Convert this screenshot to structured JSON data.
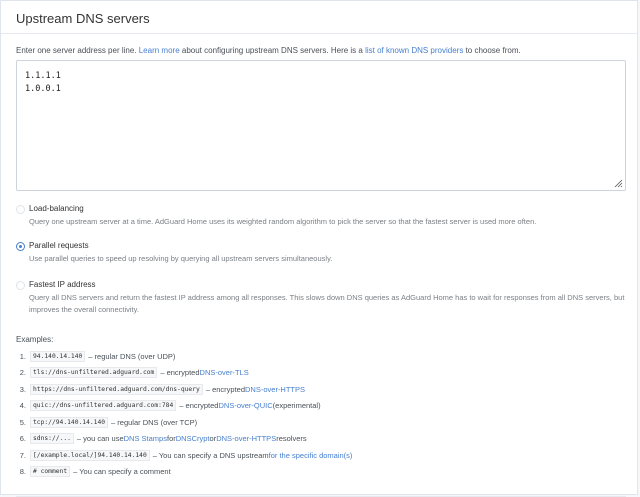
{
  "header": {
    "title": "Upstream DNS servers"
  },
  "description": {
    "part1": "Enter one server address per line. ",
    "learn_more": "Learn more",
    "part2": " about configuring upstream DNS servers. Here is a ",
    "providers_link": "list of known DNS providers",
    "part3": " to choose from."
  },
  "textarea": {
    "lines": "1.1.1.1\n1.0.0.1"
  },
  "modes": [
    {
      "title": "Load-balancing",
      "description": "Query one upstream server at a time. AdGuard Home uses its weighted random algorithm to pick the server so that the fastest server is used more often.",
      "checked": false
    },
    {
      "title": "Parallel requests",
      "description": "Use parallel queries to speed up resolving by querying all upstream servers simultaneously.",
      "checked": true
    },
    {
      "title": "Fastest IP address",
      "description": "Query all DNS servers and return the fastest IP address among all responses. This slows down DNS queries as AdGuard Home has to wait for responses from all DNS servers, but improves the overall connectivity.",
      "checked": false
    }
  ],
  "examples": {
    "title": "Examples:",
    "items": [
      {
        "num": "1.",
        "code": "94.140.14.140",
        "pre": " – regular DNS (over UDP)",
        "link": "",
        "post": ""
      },
      {
        "num": "2.",
        "code": "tls://dns-unfiltered.adguard.com",
        "pre": " – encrypted ",
        "link": "DNS-over-TLS",
        "post": ""
      },
      {
        "num": "3.",
        "code": "https://dns-unfiltered.adguard.com/dns-query",
        "pre": " – encrypted ",
        "link": "DNS-over-HTTPS",
        "post": ""
      },
      {
        "num": "4.",
        "code": "quic://dns-unfiltered.adguard.com:784",
        "pre": " – encrypted ",
        "link": "DNS-over-QUIC",
        "post": " (experimental)"
      },
      {
        "num": "5.",
        "code": "tcp://94.140.14.140",
        "pre": " – regular DNS (over TCP)",
        "link": "",
        "post": ""
      },
      {
        "num": "6.",
        "code": "sdns://...",
        "pre": " – you can use ",
        "link": "DNS Stamps",
        "post": " for ",
        "link2": "DNSCrypt",
        "post2": " or ",
        "link3": "DNS-over-HTTPS",
        "post3": " resolvers"
      },
      {
        "num": "7.",
        "code": "[/example.local/]94.140.14.140",
        "pre": " – You can specify a DNS upstream ",
        "link": "for the specific domain(s)",
        "post": ""
      },
      {
        "num": "8.",
        "code": "# comment",
        "pre": " – You can specify a comment",
        "link": "",
        "post": ""
      }
    ]
  }
}
